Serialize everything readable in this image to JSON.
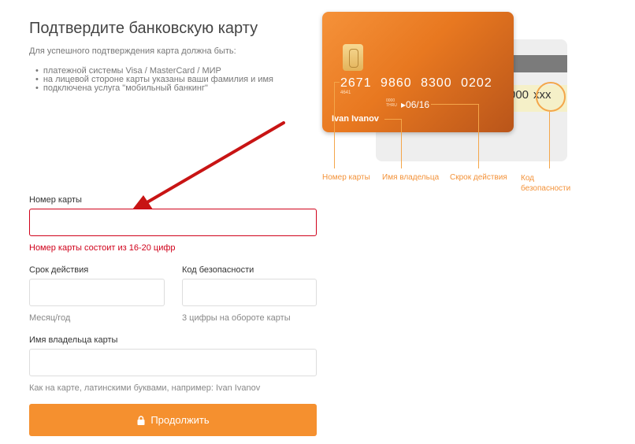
{
  "title": "Подтвердите банковскую карту",
  "requirements": {
    "intro": "Для успешного подтверждения карта должна быть:",
    "items": [
      "платежной системы Visa / MasterCard / МИР",
      "на лицевой стороне карты указаны ваши фамилия и имя",
      "подключена услуга \"мобильный банкинг\""
    ]
  },
  "card_illustration": {
    "number": "2671 9860 8300 0202",
    "number_small": "4641",
    "valid_label_1": "0000",
    "valid_label_2": "THRU",
    "expiry": "06/16",
    "owner": "Ivan Ivanov",
    "cvc_prefix": "000",
    "cvc": "xxx",
    "accent_color": "#f39239",
    "labels": {
      "number": "Номер карты",
      "owner": "Имя владельца",
      "expiry": "Скрок действия",
      "cvc_line1": "Код",
      "cvc_line2": "безопасности"
    }
  },
  "form": {
    "card_number": {
      "label": "Номер карты",
      "value": "",
      "error": "Номер карты состоит из 16-20 цифр"
    },
    "expiry": {
      "label": "Срок действия",
      "value": "",
      "hint": "Месяц/год"
    },
    "cvc": {
      "label": "Код безопасности",
      "value": "",
      "hint": "3 цифры на обороте карты"
    },
    "holder": {
      "label": "Имя владельца карты",
      "value": "",
      "hint": "Как на карте, латинскими буквами, например: Ivan Ivanov"
    },
    "submit_label": "Продолжить",
    "submit_icon": "lock-icon",
    "button_color": "#f5902f",
    "error_color": "#d0021b"
  }
}
